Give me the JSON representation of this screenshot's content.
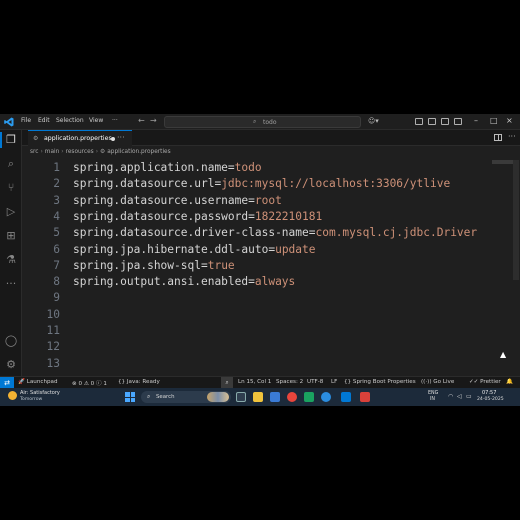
{
  "menu": {
    "file": "File",
    "edit": "Edit",
    "selection": "Selection",
    "view": "View",
    "more": "···"
  },
  "command_center": {
    "text": "todo"
  },
  "tab": {
    "label": "application.properties"
  },
  "breadcrumbs": [
    "src",
    "main",
    "resources",
    "application.properties"
  ],
  "editor": {
    "lines": [
      {
        "num": "1",
        "key": "spring.application.name=",
        "value": "todo"
      },
      {
        "num": "2",
        "key": "spring.datasource.url=",
        "value": "jdbc:mysql://localhost:3306/ytlive"
      },
      {
        "num": "3",
        "key": "spring.datasource.username=",
        "value": "root"
      },
      {
        "num": "4",
        "key": "spring.datasource.password=",
        "value": "1822210181"
      },
      {
        "num": "5",
        "key": "spring.datasource.driver-class-name=",
        "value": "com.mysql.cj.jdbc.Driver"
      },
      {
        "num": "6",
        "key": "spring.jpa.hibernate.ddl-auto=",
        "value": "update"
      },
      {
        "num": "7",
        "key": "spring.jpa.show-sql=",
        "value": "true"
      },
      {
        "num": "8",
        "key": "spring.output.ansi.enabled=",
        "value": "always"
      },
      {
        "num": "9",
        "key": "",
        "value": ""
      },
      {
        "num": "10",
        "key": "",
        "value": ""
      },
      {
        "num": "11",
        "key": "",
        "value": ""
      },
      {
        "num": "12",
        "key": "",
        "value": ""
      },
      {
        "num": "13",
        "key": "",
        "value": ""
      }
    ]
  },
  "statusbar": {
    "launchpad": "Launchpad",
    "errors": "0",
    "warnings": "0",
    "info": "1",
    "java": "Java: Ready",
    "position": "Ln 15, Col 1",
    "spaces": "Spaces: 2",
    "encoding": "UTF-8",
    "eol": "LF",
    "language": "Spring Boot Properties",
    "golive": "Go Live",
    "prettier": "Prettier"
  },
  "taskbar": {
    "weather_title": "Air: Satisfactory",
    "weather_sub": "Tomorrow",
    "search": "Search",
    "lang1": "ENG",
    "lang2": "IN",
    "time": "07:57",
    "date": "24-05-2025"
  },
  "colors": {
    "accent": "#0078d4",
    "string_value": "#ce9178",
    "editor_bg": "#1f1f1f"
  }
}
